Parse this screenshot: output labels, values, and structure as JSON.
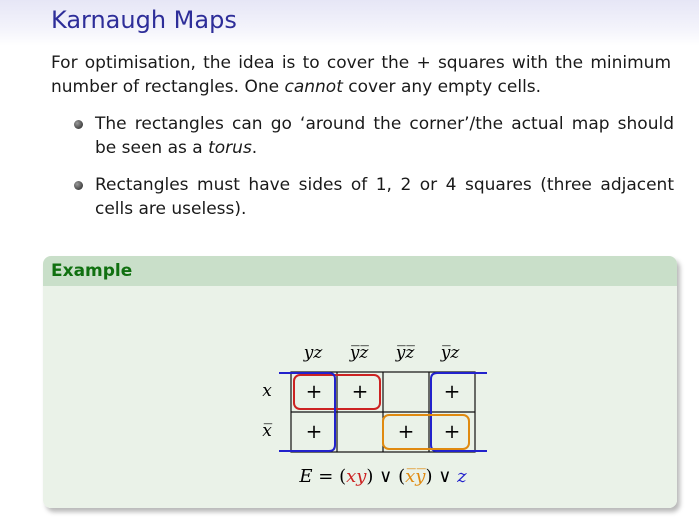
{
  "slide": {
    "title": "Karnaugh Maps",
    "intro_before_plus": "For optimisation, the idea is to cover the ",
    "plus_sign": "+",
    "intro_after_plus": " squares with the minimum number of rectangles. One ",
    "intro_emph": "cannot",
    "intro_end": " cover any empty cells.",
    "bullets": [
      {
        "before": "The rectangles can go ‘around the corner’/the actual map should be seen as a ",
        "emph": "torus",
        "after": "."
      },
      {
        "before": "Rectangles must have sides of 1, 2 or 4 squares (three adjacent cells are useless).",
        "emph": "",
        "after": ""
      }
    ]
  },
  "example": {
    "header": "Example",
    "col_headers": [
      "yz",
      "y̅z̅",
      "y̅z̅",
      "y̅z"
    ],
    "row_headers": [
      "x",
      "x̅"
    ],
    "cells": [
      [
        "+",
        "+",
        "",
        "+"
      ],
      [
        "+",
        "",
        "+",
        "+"
      ]
    ],
    "equation": {
      "lhs": "E = ",
      "term1": "xy",
      "term2": "x̅y̅",
      "term3": "z",
      "or": "∨"
    },
    "colors": {
      "term1": "#cc2222",
      "term2": "#e08a10",
      "term3": "#2222cc"
    }
  }
}
